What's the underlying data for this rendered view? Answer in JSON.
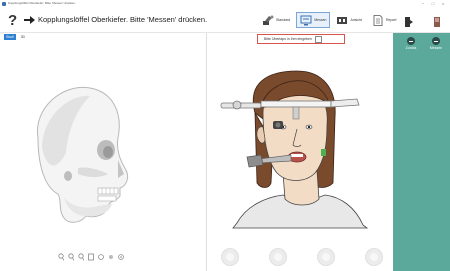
{
  "window": {
    "title": "Kopplungslöffel Oberkiefer: Bitte 'Messen' drücken.",
    "controls": {
      "minimize": "−",
      "maximize": "□",
      "close": "×"
    }
  },
  "header": {
    "help_icon": "?",
    "instruction": "Kopplungslöffel Oberkiefer. Bitte 'Messen' drücken."
  },
  "toolbar": {
    "items": [
      {
        "label": "Standard",
        "icon": "tools-icon",
        "active": false
      },
      {
        "label": "Messen",
        "icon": "measure-icon",
        "active": true
      },
      {
        "label": "Ansicht",
        "icon": "view-icon",
        "active": false
      },
      {
        "label": "Report",
        "icon": "report-icon",
        "active": false
      }
    ]
  },
  "left_pane": {
    "tabs": [
      "Skull",
      "3D"
    ],
    "view_controls": [
      "zoom-in-icon",
      "zoom-out-icon",
      "zoom-fit-icon",
      "rotate-icon",
      "pan-icon",
      "reset-icon",
      "settings-icon"
    ]
  },
  "center_pane": {
    "overlay_toggle_label": "Bitte Überlaps in Ihm eingeben",
    "overlay_toggle_checked": false
  },
  "side_panel": {
    "buttons": [
      {
        "label": "Zurück",
        "icon": "minus-circle-icon"
      },
      {
        "label": "Messen",
        "icon": "minus-circle-icon"
      }
    ]
  },
  "colors": {
    "teal_panel": "#5ba99a",
    "active_tab": "#2f7fd1",
    "highlight_border": "#d9534f",
    "hair": "#7a4a2c",
    "skin": "#f3dcc6",
    "shirt": "#e8e8e8"
  }
}
